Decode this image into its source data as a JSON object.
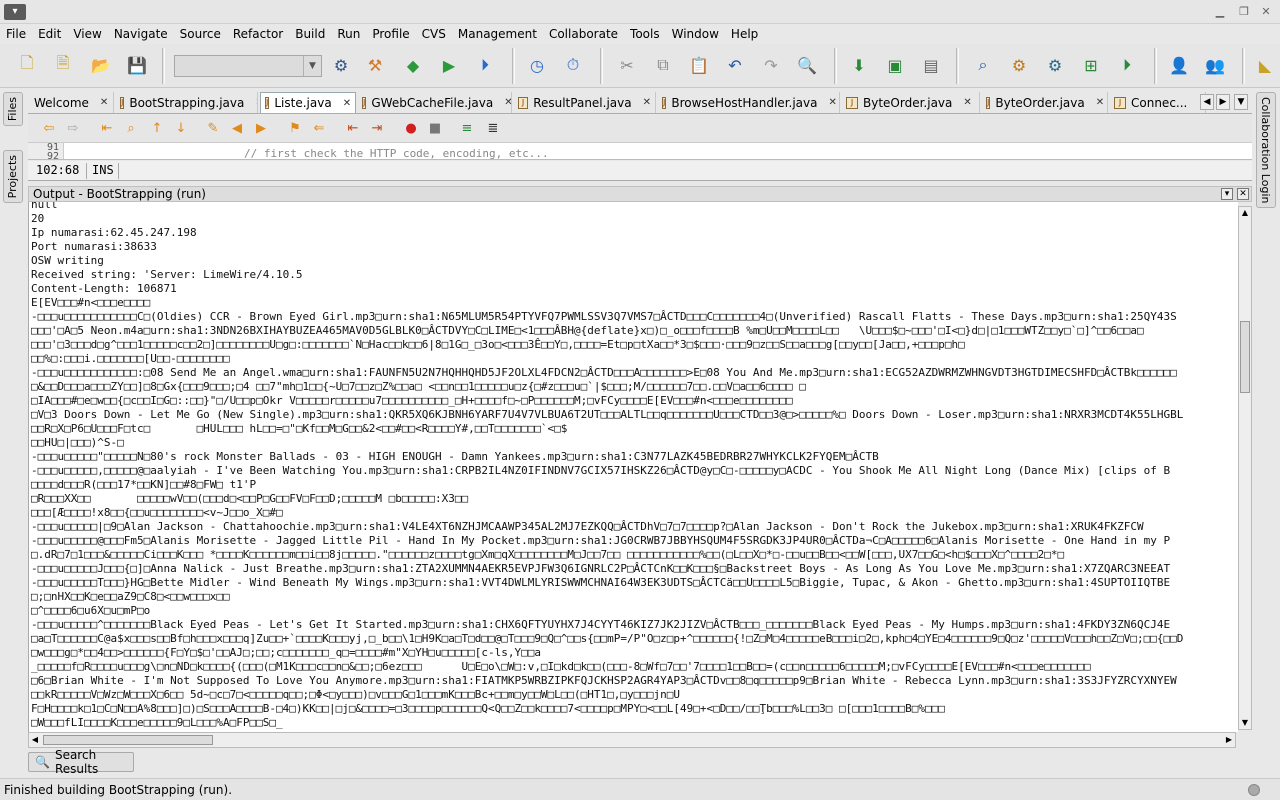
{
  "menu": [
    "File",
    "Edit",
    "View",
    "Navigate",
    "Source",
    "Refactor",
    "Build",
    "Run",
    "Profile",
    "CVS",
    "Management",
    "Collaborate",
    "Tools",
    "Window",
    "Help"
  ],
  "side_tabs": {
    "files": "Files",
    "projects": "Projects",
    "collab": "Collaboration Login"
  },
  "editor_tabs": [
    {
      "label": "Welcome",
      "active": false
    },
    {
      "label": "BootStrapping.java",
      "active": false
    },
    {
      "label": "Liste.java",
      "active": true
    },
    {
      "label": "GWebCacheFile.java",
      "active": false
    },
    {
      "label": "ResultPanel.java",
      "active": false
    },
    {
      "label": "BrowseHostHandler.java",
      "active": false
    },
    {
      "label": "ByteOrder.java",
      "active": false
    },
    {
      "label": "ByteOrder.java",
      "active": false
    },
    {
      "label": "Connec...",
      "active": false
    }
  ],
  "editor": {
    "line_numbers": "91\n92",
    "code": "// first check the HTTP code, encoding, etc..."
  },
  "status_line": {
    "position": "102:68",
    "mode": "INS"
  },
  "output": {
    "title": "Output - BootStrapping (run)",
    "lines": [
      "null",
      "20",
      "Ip numarasi:62.45.247.198",
      "Port numarasi:38633",
      "OSW writing",
      "Received string: 'Server: LimeWire/4.10.5",
      "Content-Length: 106871",
      "E[EV□□□#n<□□□e□□□□",
      "-□□□u□□□□□□□□□□□C□(Oldies) CCR - Brown Eyed Girl.mp3□urn:sha1:N65MLUM5R54PTYVFQ7PWMLSSV3Q7VMS7□ÂCTD□□□C□□□□□□□4□(Unverified) Rascall Flatts - These Days.mp3□urn:sha1:25QY43S",
      "□□□'□A□5 Neon.m4a□urn:sha1:3NDN26BXIHAYBUZEA465MAV0D5GLBLK0□ÂCTDVY□C□LIME□<1□□□ÂBH@{deflate}x□)□_o□□□f□□□□B %m□U□□M□□□□L□□   \\U□□□$□~□□□'□I<□}d□|□1□□□WTZ□□y□`□]^□□6□□a□",
      "□□□'□3□□□d□g^□□□1□□□□□c□□2□]□□□□□□□□U□g□:□□□□□□□`N□Hac□□k□□6|8□1G□_□3o□<□□□3Ê□□Y□,□□□□=Et□p□tXa□□*3□$□□□·□□□9□z□□S□□a□□□g[□□y□□[Ja□□,+□□□p□h□",
      "□□%□:□□□i.□□□□□□□[U□□-□□□□□□□□",
      "-□□□u□□□□□□□□□□□:□08 Send Me an Angel.wma□urn:sha1:FAUNFN5U2N7HQHHQHD5JF2OLXL4FDCN2□ÂCTD□□□A□□□□□□□>E□08 You And Me.mp3□urn:sha1:ECG52AZDWRMZWHNGVDT3HGTDIMECSHFD□ÂCTBk□□□□□□",
      "□&□□D□□□a□□□ZY□□]□8□Gx{□□□9□□□;□4 □□7\"mh□1□□{~U□7□□z□Z%□□a□ <□□n□□1□□□□□u□z{□#z□□□u□`|$□□□;M/□□□□□□7□□.□□V□a□□6□□□□ □",
      "□IA□□□#□e□w□□{□c□□I□G□::□□}\"□/U□□p□Okr V□□□□□r□□□□□u7□□□□□□□□□□_□H+□□□□f□~□P□□□□□□M;□vFCy□□□□E[EV□□□#n<□□□e□□□□□□□□",
      "□V□3 Doors Down - Let Me Go (New Single).mp3□urn:sha1:QKR5XQ6KJBNH6YARF7U4V7VLBUA6T2UT□□□ALTL□□q□□□□□□□U□□□CTD□□3@□>□□□□□%□ Doors Down - Loser.mp3□urn:sha1:NRXR3MCDT4K55LHGBL",
      "□□R□X□P6□U□□□F□tc□       □HUL□□□ hL□□=□\"□Kf□□M□G□□&2<□□#□□<R□□□□Y#,□□T□□□□□□□`<□$",
      "□□HU□|□□□)^S-□",
      "-□□□u□□□□□\"□□□□□N□80's rock Monster Ballads - 03 - HIGH ENOUGH - Damn Yankees.mp3□urn:sha1:C3N77LAZK45BEDRBR27WHYKCLK2FYQEM□ÂCTB",
      "-□□□u□□□□□,□□□□□@□aalyiah - I've Been Watching You.mp3□urn:sha1:CRPB2IL4NZ0IFINDNV7GCIX57IHSKZ26□ÂCTD@y□C□-□□□□□y□ACDC - You Shook Me All Night Long (Dance Mix) [clips of B",
      "□□□□d□□□R(□□□17*□□KN]□□#8□FW□ t1'P",
      "□R□□□XX□□       □□□□□wV□□(□□□d□<□□P□G□□FV□F□□D;□□□□□M □b□□□□□:X3□□",
      "□□□[Æ□□□□!x8□□{□□u□□□□□□□□<v~J□□o_X□#□",
      "-□□□u□□□□□|□9□Alan Jackson - Chattahoochie.mp3□urn:sha1:V4LE4XT6NZHJMCAAWP345AL2MJ7EZKQQ□ÂCTDhV□7□7□□□□p?□Alan Jackson - Don't Rock the Jukebox.mp3□urn:sha1:XRUK4FKZFCW",
      "-□□□u□□□□□@□□□Fm5□Alanis Morisette - Jagged Little Pil - Hand In My Pocket.mp3□urn:sha1:JG0CRWB7JBBYHSQUM4F5SRGDK3JP4UR0□ÂCTDa¬C□A□□□□□6□Alanis Morisette - One Hand in my P",
      "□.dR□7□1□□□&□□□□□Ci□□□K□□□ *□□□□K□□□□□□m□□i□□8j□□□□□.\"□□□□□□z□□□□tg□Xm□qX□□□□□□□□M□J□□7□□ □□□□□□□□□□□%□□(□L□□X□*□-□□u□□B□□<□□W[□□□,UX7□□G□<h□$□□□X□^□□□□2□*□",
      "-□□□u□□□□□J□□□{□]□Anna Nalick - Just Breathe.mp3□urn:sha1:ZTA2XUMMN4AEKR5EVPJFW3Q6IGNRLC2P□ÂCTCnK□□K□□□§□Backstreet Boys - As Long As You Love Me.mp3□urn:sha1:X7ZQARC3NEEAT",
      "-□□□u□□□□□T□□□}HG□Bette Midler - Wind Beneath My Wings.mp3□urn:sha1:VVT4DWLMLYRISWWMCHNAI64W3EK3UDTS□ÂCTCä□□U□□□□L5□Biggie, Tupac, & Akon - Ghetto.mp3□urn:sha1:4SUPTOIIQTBE",
      "□;□nHX□□K□e□□aZ9□C8□<□□w□□□x□□",
      "□^□□□□6□u6X□u□mP□o",
      "-□□□u□□□□□^□□□□□□□Black Eyed Peas - Let's Get It Started.mp3□urn:sha1:CHX6QFTYUYHX7J4CYYT46KIZ7JK2JIZV□ÂCTB□□□_□□□□□□□Black Eyed Peas - My Humps.mp3□urn:sha1:4FKDY3ZN6QCJ4E",
      "□a□T□□□□□□C@a$x□□□s□□Bf□h□□□x□□□q]Zu□□+`□□□□K□□□yj,□_b□□\\1□H9K□a□T□d□□@□T□□□9□Q□^□□s{□□mP=/P\"O□z□p+^□□□□□□{!□Z□M□4□□□□□eB□□□i□2□,kph□4□YE□4□□□□□□9□Q□z'□□□□□V□□□h□□Z□V□;□□{□□D",
      "□w□□□g□*□□4□□>□□□□□□{F□Y□$□'□□AJ□;□□;c□□□□□□□_q□=□□□□#m\"X□YH□u□□□□□[c-ls,Y□□a",
      "_□□□□□f□R□□□□u□□□g\\□n□ND□k□□□□{(□□□(□M1K□□□c□□n□&□□;□6ez□□□      U□E□o\\□W□:v,□I□kd□k□□(□□□-8□Wf□7□□'7□□□□1□□B□□=(c□□n□□□□□6□□□□□M;□vFCy□□□□E[EV□□□#n<□□□e□□□□□□□",
      "□6□Brian White - I'm Not Supposed To Love You Anymore.mp3□urn:sha1:FIATMKP5WRBZIPKFQJCKHSP2AGR4YAP3□ÂCTDv□□8□q□□□□□p9□Brian White - Rebecca Lynn.mp3□urn:sha1:3S3JFYZRCYXNYEW",
      "□□kR□□□□□V□Wz□W□□□X□6□□ 5d~□c□7□<□□□□□q□□;□Φ<□y□□□)□v□□□G□1□□□mK□□□Bc+□□m□y□□W□L□□(□HT1□,□y□□□jn□U",
      "F□H□□□□k□1□C□N□□A%8□□□]□)□S□□□A□□□□B-□4□)KK□□|□j□&□□□□=□3□□□□p□□□□□□Q<Q□□Z□□k□□□□7<□□□□p□MPY□<□□L[49□+<□D□□/□□Ţb□□□%L□□3□ □[□□□1□□□□B□%□□□",
      "□W□□□fLI□□□□K□□□e□□□□□9□L□□□%A□FP□□S□_"
    ]
  },
  "bottom": {
    "search_results": "Search Results",
    "status_message": "Finished building BootStrapping (run)."
  }
}
